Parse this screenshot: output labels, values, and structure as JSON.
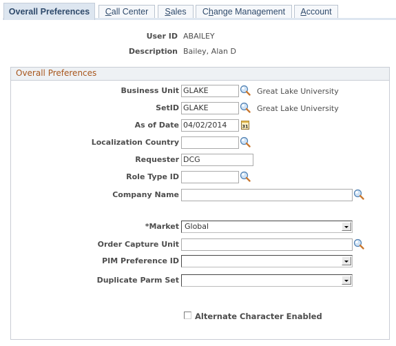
{
  "tabs": [
    {
      "label": "Overall Preferences",
      "accel_index": -1,
      "active": true
    },
    {
      "label": "Call Center",
      "accel_index": 0,
      "active": false
    },
    {
      "label": "Sales",
      "accel_index": 0,
      "active": false
    },
    {
      "label": "Change Management",
      "accel_index": 1,
      "active": false
    },
    {
      "label": "Account",
      "accel_index": 0,
      "active": false
    }
  ],
  "header": {
    "user_id_label": "User ID",
    "user_id_value": "ABAILEY",
    "description_label": "Description",
    "description_value": "Bailey, Alan D"
  },
  "group": {
    "title": "Overall Preferences",
    "fields": {
      "business_unit": {
        "label": "Business Unit",
        "value": "GLAKE",
        "description": "Great Lake University",
        "icon": "lookup-icon"
      },
      "setid": {
        "label": "SetID",
        "value": "GLAKE",
        "description": "Great Lake University",
        "icon": "lookup-icon"
      },
      "as_of_date": {
        "label": "As of Date",
        "value": "04/02/2014",
        "icon": "calendar-icon"
      },
      "localization_country": {
        "label": "Localization Country",
        "value": "",
        "icon": "lookup-icon"
      },
      "requester": {
        "label": "Requester",
        "value": "DCG"
      },
      "role_type_id": {
        "label": "Role Type ID",
        "value": "",
        "icon": "lookup-icon"
      },
      "company_name": {
        "label": "Company Name",
        "value": "",
        "icon": "lookup-icon"
      },
      "market": {
        "label": "*Market",
        "value": "Global"
      },
      "order_capture_unit": {
        "label": "Order Capture Unit",
        "value": "",
        "icon": "lookup-icon"
      },
      "pim_preference_id": {
        "label": "PIM Preference ID",
        "value": ""
      },
      "duplicate_parm_set": {
        "label": "Duplicate Parm Set",
        "value": ""
      },
      "alternate_character": {
        "label": "Alternate Character Enabled",
        "checked": false
      }
    }
  },
  "colors": {
    "group_title": "#a8561c",
    "tab_text": "#2f4a6b",
    "tab_active_bg": "#dde6f0",
    "label_text": "#4d4d4d"
  }
}
